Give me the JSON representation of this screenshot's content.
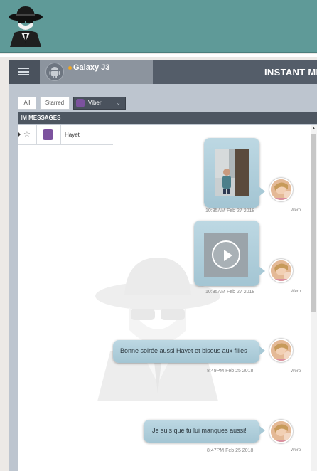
{
  "app": {
    "logo_icon": "spy-agent-logo-icon",
    "device_name": "Galaxy J3",
    "device_icon": "android-icon",
    "device_status_color": "#f0a622",
    "title": "INSTANT ME"
  },
  "tabs": {
    "all_label": "All",
    "starred_label": "Starred",
    "app_filter_label": "Viber",
    "app_filter_icon": "viber-icon"
  },
  "section": {
    "title": "IM MESSAGES"
  },
  "conversations": [
    {
      "name": "Hayet",
      "app_icon": "viber-icon",
      "starred": false
    }
  ],
  "messages": [
    {
      "type": "image",
      "time": "10:35AM Feb 27 2018",
      "sender": "Wero"
    },
    {
      "type": "video",
      "time": "10:35AM Feb 27 2018",
      "sender": "Wero"
    },
    {
      "type": "text",
      "text": "Bonne soirée aussi Hayet et bisous aux filles",
      "time": "8:49PM Feb 25 2018",
      "sender": "Wero"
    },
    {
      "type": "text",
      "text": "Je suis que tu lui manques aussi!",
      "time": "8:47PM Feb 25 2018",
      "sender": "Wero"
    }
  ],
  "colors": {
    "header_bg": "#5f9a98",
    "bubble": "#b0cfdc",
    "viber": "#7c529e"
  }
}
